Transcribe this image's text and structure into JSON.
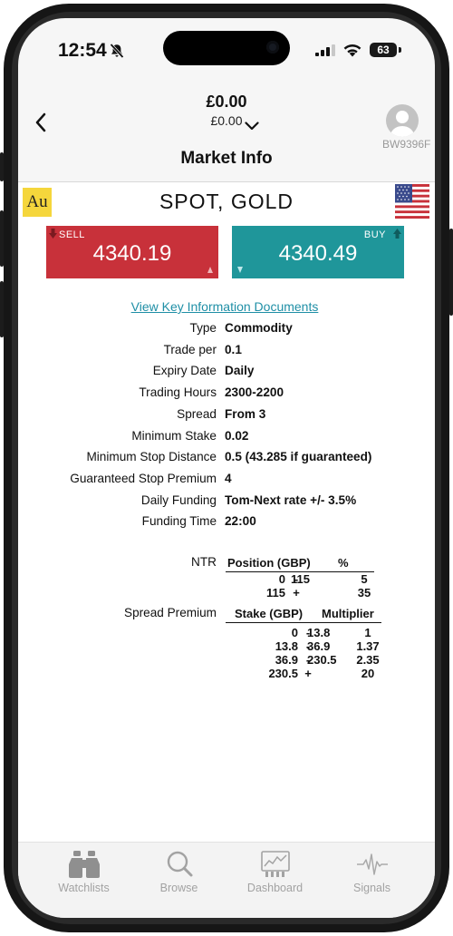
{
  "status": {
    "time": "12:54",
    "battery": "63"
  },
  "header": {
    "balance": "£0.00",
    "balance_sub": "£0.00",
    "account_id": "BW9396F"
  },
  "page_title": "Market Info",
  "instrument": {
    "symbol_badge": "Au",
    "name": "SPOT, GOLD",
    "flag": "us-flag-icon"
  },
  "sell": {
    "label": "SELL",
    "price": "4340.19"
  },
  "buy": {
    "label": "BUY",
    "price": "4340.49"
  },
  "colors": {
    "sell": "#c8313a",
    "buy": "#1f969a",
    "link": "#1f8fa6"
  },
  "kid_link": "View Key Information Documents",
  "info_rows": [
    {
      "label": "Type",
      "value": "Commodity"
    },
    {
      "label": "Trade per",
      "value": "0.1"
    },
    {
      "label": "Expiry Date",
      "value": "Daily"
    },
    {
      "label": "Trading Hours",
      "value": "2300-2200"
    },
    {
      "label": "Spread",
      "value": "From 3"
    },
    {
      "label": "Minimum Stake",
      "value": "0.02"
    },
    {
      "label": "Minimum Stop Distance",
      "value": "0.5 (43.285 if guaranteed)"
    },
    {
      "label": "Guaranteed Stop Premium",
      "value": "4"
    },
    {
      "label": "Daily Funding",
      "value": "Tom-Next rate +/- 3.5%"
    },
    {
      "label": "Funding Time",
      "value": "22:00"
    }
  ],
  "ntr": {
    "label": "NTR",
    "headers": [
      "Position (GBP)",
      "%"
    ],
    "rows": [
      {
        "from": "0",
        "sep": "-",
        "to": "115",
        "value": "5"
      },
      {
        "from": "115",
        "sep": "+",
        "to": "",
        "value": "35"
      }
    ]
  },
  "spread_premium": {
    "label": "Spread Premium",
    "headers": [
      "Stake (GBP)",
      "Multiplier"
    ],
    "rows": [
      {
        "from": "0",
        "sep": "-",
        "to": "13.8",
        "value": "1"
      },
      {
        "from": "13.8",
        "sep": "-",
        "to": "36.9",
        "value": "1.37"
      },
      {
        "from": "36.9",
        "sep": "-",
        "to": "230.5",
        "value": "2.35"
      },
      {
        "from": "230.5",
        "sep": "+",
        "to": "",
        "value": "20"
      }
    ]
  },
  "tabs": [
    {
      "label": "Watchlists",
      "icon": "binoculars-icon"
    },
    {
      "label": "Browse",
      "icon": "magnifier-icon"
    },
    {
      "label": "Dashboard",
      "icon": "dashboard-icon"
    },
    {
      "label": "Signals",
      "icon": "pulse-icon"
    }
  ]
}
